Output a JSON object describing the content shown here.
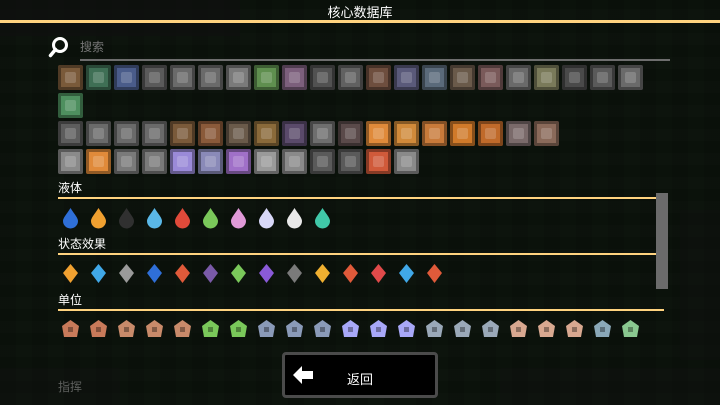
{
  "window": {
    "title": "核心数据库"
  },
  "search": {
    "placeholder": "搜索",
    "value": ""
  },
  "sections": {
    "liquids": {
      "title": "液体"
    },
    "status_effects": {
      "title": "状态效果"
    },
    "units": {
      "title": "单位"
    }
  },
  "footer": {
    "back_label": "返回",
    "bottom_left_label": "指挥"
  },
  "colors": {
    "accent": "#ffd37f",
    "background": "#000000"
  },
  "blocks": {
    "row1": [
      "#7a5a3a",
      "#3f6f55",
      "#4a5c8a",
      "#5a5a5a",
      "#6a6a6a",
      "#6a6a6a",
      "#7a7a7a",
      "#5f8f4f",
      "#7c5f7c",
      "#515151",
      "#616161",
      "#6e4e3e",
      "#5a5a7a",
      "#5a6a7a",
      "#6a5a4a",
      "#7a5a5a",
      "#6a6a6a",
      "#7a7a5a",
      "#4a4a4a",
      "#5a5a5a",
      "#6a6a6a",
      "#4e8f5f"
    ],
    "row2": [
      "#5d5d5d",
      "#6a6a6a",
      "#6a6a6a",
      "#6a6a6a",
      "#7a5a3a",
      "#8a5a3a",
      "#6a5a4a",
      "#8a6a3a",
      "#5a4a6a",
      "#6e6e6e",
      "#5a4a4a",
      "#e08a3a",
      "#d08a3a",
      "#c87a3a",
      "#d07a2a",
      "#c06a2a",
      "#7a6a6a",
      "#8a6a5a"
    ],
    "row3": [
      "#8a8a8a",
      "#e08a3a",
      "#7a7a7a",
      "#7a7a7a",
      "#9a8ad8",
      "#8a8ab8",
      "#a070c8",
      "#9a9a9a",
      "#8a8a8a",
      "#5a5a5a",
      "#5a5a5a",
      "#d05a3a",
      "#8a8a8a"
    ],
    "liquids": [
      "#2f6fd8",
      "#f0a030",
      "#303030",
      "#5ab8e8",
      "#e04a3a",
      "#7ac85a",
      "#e09ad8",
      "#d8d8f8",
      "#e8e8e8",
      "#40c8a8"
    ],
    "status_effects": [
      "#f0a030",
      "#40a8e8",
      "#9a9a9a",
      "#2f6fd8",
      "#e05a3a",
      "#7a5aa8",
      "#7ac85a",
      "#8a5ad8",
      "#7a7a7a",
      "#f0b030",
      "#e05a3a",
      "#e04a4a",
      "#40a8e8",
      "#e05a3a"
    ],
    "units_row1": [
      "#c87a5a",
      "#c87a5a",
      "#c88a6a",
      "#c88a6a",
      "#c88a6a",
      "#7ac85a",
      "#7ac85a",
      "#8a9ab8",
      "#8a9ab8",
      "#8a9ab8",
      "#a8a8f8",
      "#a8a8f8",
      "#a8a8f8",
      "#9aa8b8",
      "#9aa8b8",
      "#9aa8b8",
      "#d8a890",
      "#d8a890",
      "#d8a890",
      "#8aa8b8",
      "#8ac890"
    ],
    "units_row2": [
      "#a8a8b8",
      "#a8a8b8",
      "#a8a8b8",
      "#a8a8b8",
      "#a8a8b8",
      "#7ac85a",
      "#7ac85a",
      "#9a9a9a",
      "#9a9a9a",
      "#9a9a9a",
      "#b8a8d8",
      "#b8a8d8",
      "#b8a8d8",
      "#9aa8b8",
      "#9aa8b8",
      "#9aa8b8",
      "#d8a890",
      "#d8a890",
      "#d8a890",
      "#8aa8b8",
      "#8ac890"
    ]
  },
  "icons": {
    "search": "search-icon",
    "back": "arrow-left-icon"
  }
}
